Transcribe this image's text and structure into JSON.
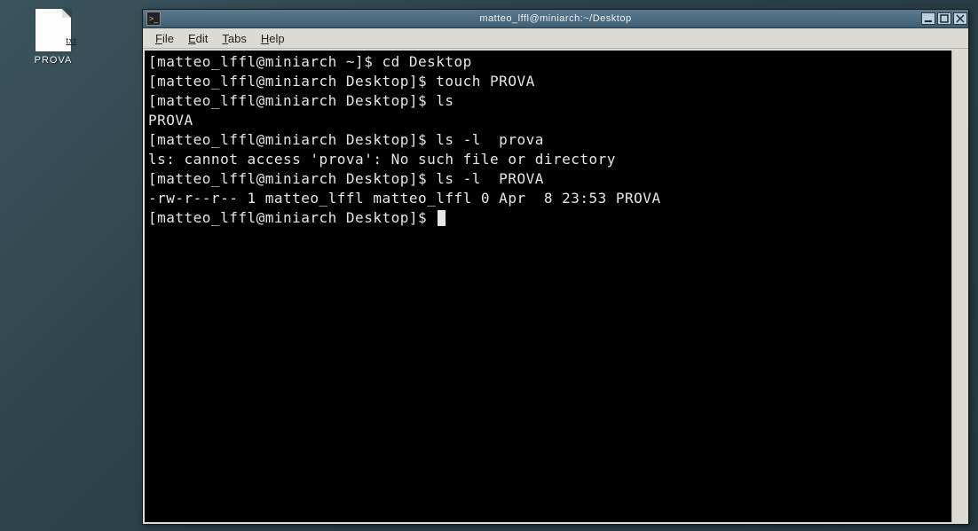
{
  "desktop": {
    "icon": {
      "type": "txt",
      "label": "PROVA"
    }
  },
  "window": {
    "title": "matteo_lffl@miniarch:~/Desktop",
    "menubar": [
      {
        "accel": "F",
        "rest": "ile"
      },
      {
        "accel": "E",
        "rest": "dit"
      },
      {
        "accel": "T",
        "rest": "abs"
      },
      {
        "accel": "H",
        "rest": "elp"
      }
    ],
    "terminal": {
      "lines": [
        "[matteo_lffl@miniarch ~]$ cd Desktop",
        "[matteo_lffl@miniarch Desktop]$ touch PROVA",
        "[matteo_lffl@miniarch Desktop]$ ls",
        "PROVA",
        "[matteo_lffl@miniarch Desktop]$ ls -l  prova",
        "ls: cannot access 'prova': No such file or directory",
        "[matteo_lffl@miniarch Desktop]$ ls -l  PROVA",
        "-rw-r--r-- 1 matteo_lffl matteo_lffl 0 Apr  8 23:53 PROVA"
      ],
      "prompt": "[matteo_lffl@miniarch Desktop]$ "
    }
  }
}
